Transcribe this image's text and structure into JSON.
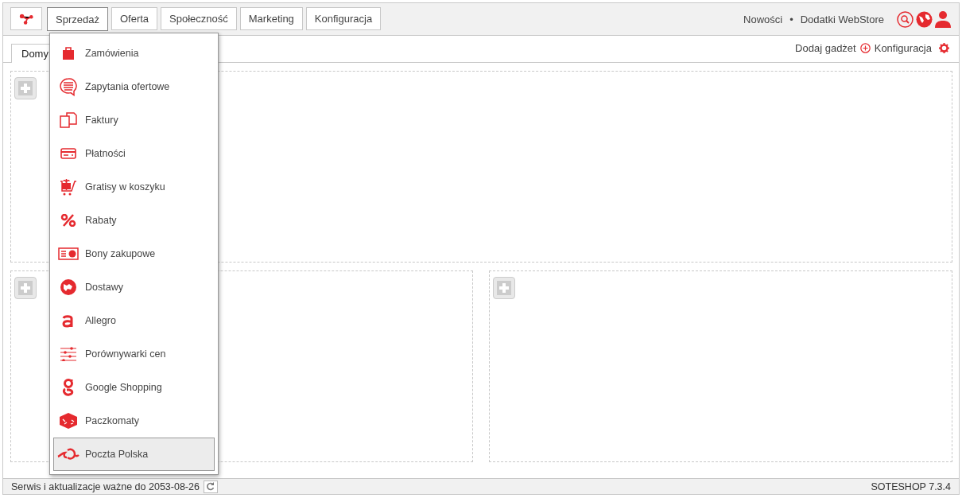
{
  "top_nav": {
    "tabs": [
      {
        "label": "Sprzedaż",
        "selected": true
      },
      {
        "label": "Oferta",
        "selected": false
      },
      {
        "label": "Społeczność",
        "selected": false
      },
      {
        "label": "Marketing",
        "selected": false
      },
      {
        "label": "Konfiguracja",
        "selected": false
      }
    ],
    "links": [
      "Nowości",
      "Dodatki WebStore"
    ],
    "separator": "•"
  },
  "dashboard": {
    "tabs": [
      {
        "label": "Domy",
        "selected": true
      }
    ],
    "actions": [
      "Dodaj gadżet",
      "Konfiguracja"
    ]
  },
  "sales_menu": {
    "items": [
      {
        "label": "Zamówienia",
        "selected": false
      },
      {
        "label": "Zapytania ofertowe",
        "selected": false
      },
      {
        "label": "Faktury",
        "selected": false
      },
      {
        "label": "Płatności",
        "selected": false
      },
      {
        "label": "Gratisy w koszyku",
        "selected": false
      },
      {
        "label": "Rabaty",
        "selected": false
      },
      {
        "label": "Bony zakupowe",
        "selected": false
      },
      {
        "label": "Dostawy",
        "selected": false
      },
      {
        "label": "Allegro",
        "selected": false
      },
      {
        "label": "Porównywarki cen",
        "selected": false
      },
      {
        "label": "Google Shopping",
        "selected": false
      },
      {
        "label": "Paczkomaty",
        "selected": false
      },
      {
        "label": "Poczta Polska",
        "selected": true
      }
    ]
  },
  "status_bar": {
    "license": "Serwis i aktualizacje ważne do 2053-08-26",
    "version": "SOTESHOP 7.3.4"
  }
}
